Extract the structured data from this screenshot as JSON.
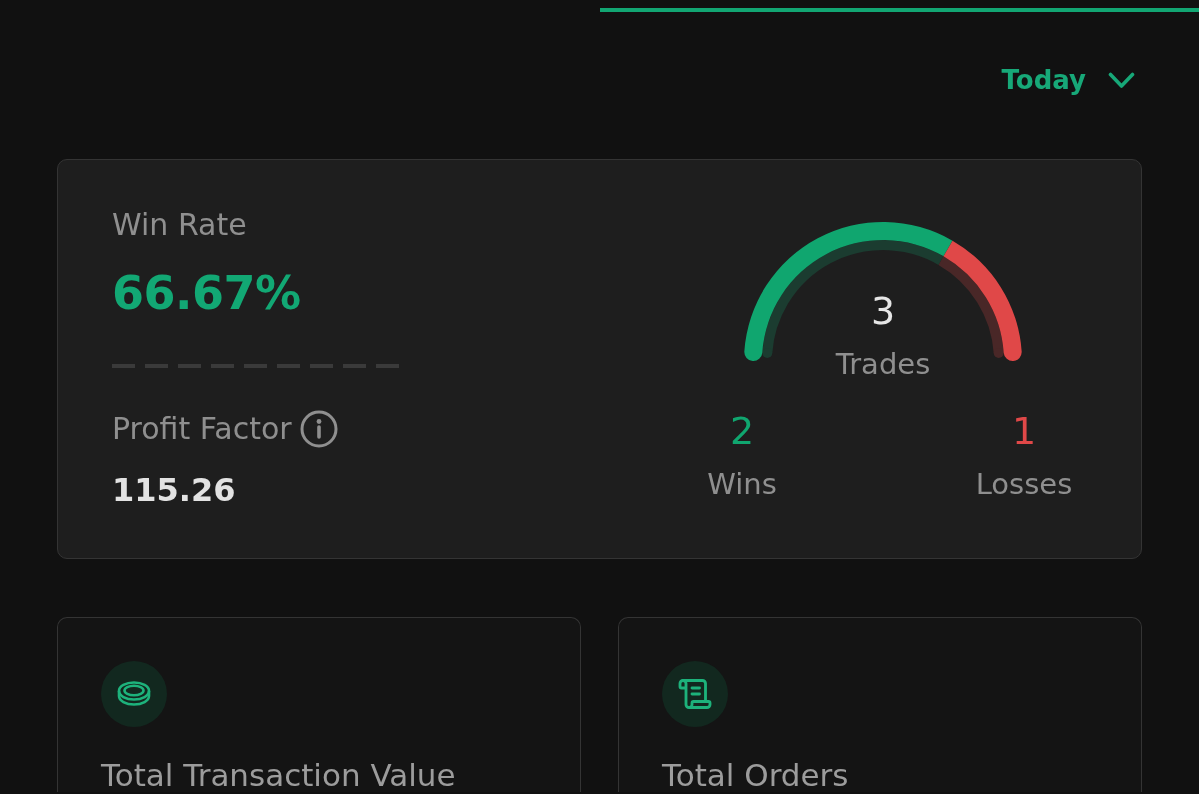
{
  "period_selector": {
    "label": "Today"
  },
  "stats_card": {
    "win_rate": {
      "label": "Win Rate",
      "value": "66.67%"
    },
    "profit_factor": {
      "label": "Profit Factor",
      "value": "115.26"
    },
    "trades": {
      "total": "3",
      "label": "Trades",
      "chart_data": {
        "type": "donut",
        "values": [
          66.67,
          33.33
        ],
        "colors": [
          "#10a66f",
          "#e04848"
        ]
      }
    },
    "outcomes": [
      {
        "count": "2",
        "label": "Wins",
        "color": "#10a66f"
      },
      {
        "count": "1",
        "label": "Losses",
        "color": "#e04848"
      }
    ]
  },
  "summary_cards": [
    {
      "kind": "value",
      "title": "Total Transaction Value"
    },
    {
      "kind": "orders",
      "title": "Total Orders"
    }
  ]
}
